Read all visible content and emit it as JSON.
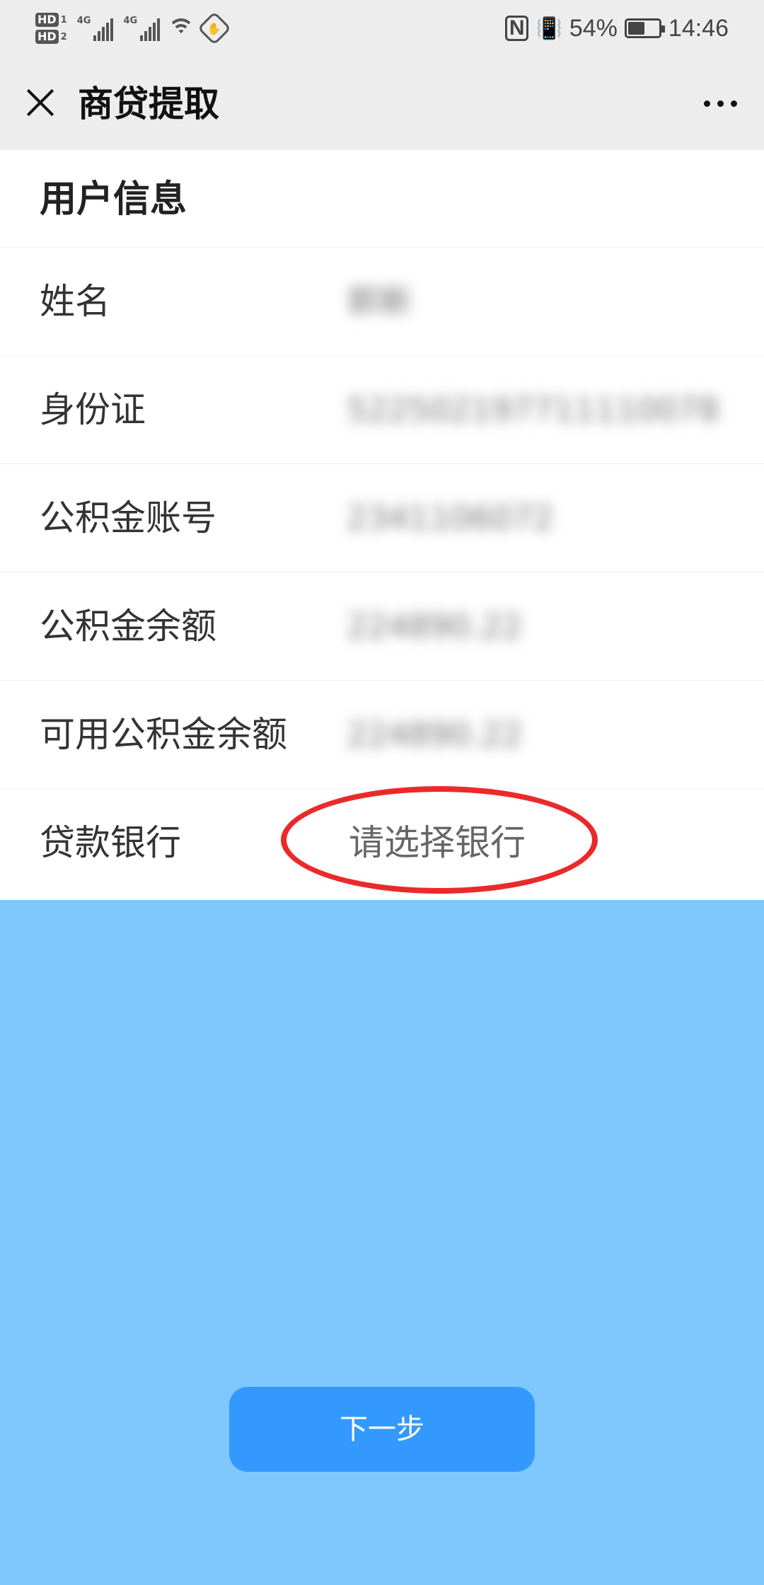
{
  "status_bar": {
    "sim1_tag": "HD",
    "sim1_num": "1",
    "sim2_tag": "HD",
    "sim2_num": "2",
    "network1": "4G",
    "network2": "4G",
    "nfc_label": "N",
    "battery_percent": "54%",
    "battery_level": 0.54,
    "time": "14:46"
  },
  "nav": {
    "title": "商贷提取"
  },
  "user_info": {
    "section_title": "用户信息",
    "rows": [
      {
        "label": "姓名",
        "value": "郭新"
      },
      {
        "label": "身份证",
        "value": "522502197711110078"
      },
      {
        "label": "公积金账号",
        "value": "2341106072"
      },
      {
        "label": "公积金余额",
        "value": "224890.22"
      },
      {
        "label": "可用公积金余额",
        "value": "224890.22"
      }
    ],
    "bank_row": {
      "label": "贷款银行",
      "placeholder": "请选择银行"
    }
  },
  "next_button": {
    "label": "下一步"
  },
  "colors": {
    "highlight_circle": "#ea2a2a",
    "button_bg": "#3399ff",
    "page_bg": "#7ec8fd"
  }
}
